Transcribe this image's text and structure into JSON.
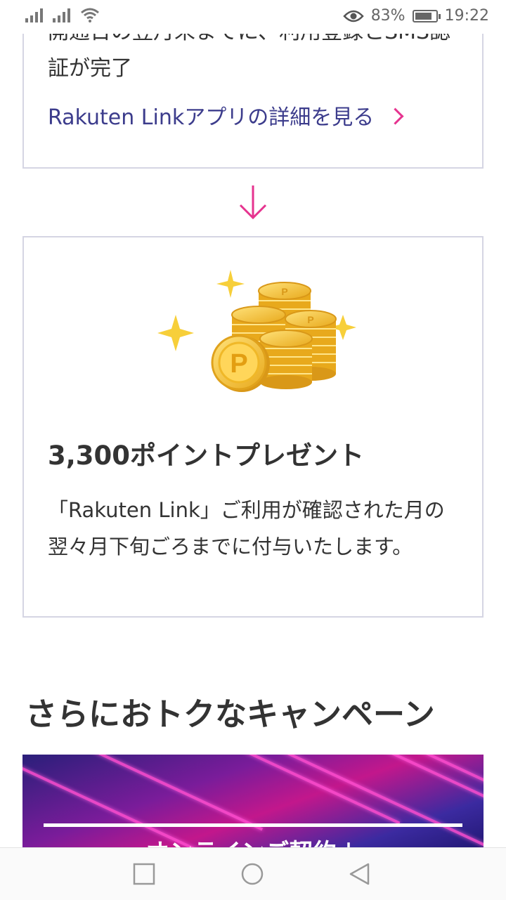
{
  "status_bar": {
    "battery": "83%",
    "time": "19:22",
    "battery_level": 0.83
  },
  "card1": {
    "text": "開通日の翌月末までに、利用登録とSMS認証が完了",
    "link": "Rakuten Linkアプリの詳細を見る"
  },
  "card2": {
    "title": "3,300ポイントプレゼント",
    "description": "「Rakuten Link」ご利用が確認された月の翌々月下旬ごろまでに付与いたします。",
    "coin_mark": "P"
  },
  "section": {
    "title": "さらにおトクなキャンペーン"
  },
  "banner": {
    "title": "オンラインご契約＋"
  },
  "colors": {
    "accent": "#e6338f",
    "link": "#3c3c8c",
    "border": "#d5d5e3",
    "coin": "#f5c12e"
  },
  "icons": [
    "signal-icon",
    "wifi-icon",
    "eye-icon",
    "battery-icon",
    "chevron-right-icon",
    "arrow-down-icon",
    "coins-icon",
    "sparkle-icon",
    "square-icon",
    "circle-icon",
    "back-icon"
  ]
}
